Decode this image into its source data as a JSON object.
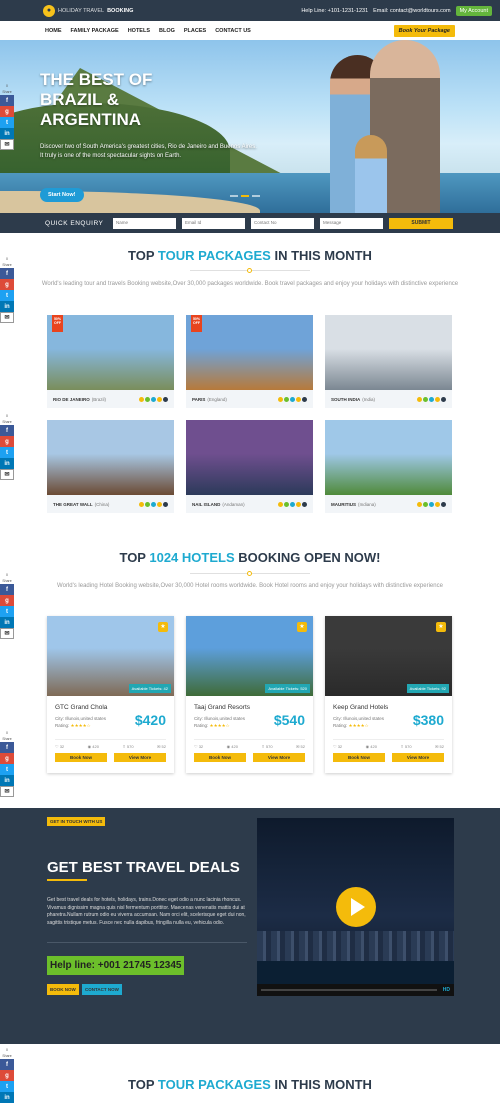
{
  "topbar": {
    "logo_text": "HOLIDAY TRAVEL",
    "logo_bold": "BOOKING",
    "helpline": "Help Line: +101-1231-1231",
    "email": "Email: contact@worldtours.com",
    "my_account": "My Account"
  },
  "nav": {
    "items": [
      "HOME",
      "FAMILY PACKAGE",
      "HOTELS",
      "BLOG",
      "PLACES",
      "CONTACT US"
    ],
    "book_label": "Book Your Package"
  },
  "hero": {
    "title": "THE BEST OF BRAZIL & ARGENTINA",
    "description": "Discover two of South America's greatest cities, Rio de Janeiro and Buenos Aires. It truly is one of the most spectacular sights on Earth.",
    "button": "Start Now!"
  },
  "enquiry": {
    "label": "QUICK ENQUIRY",
    "name_ph": "Name",
    "email_ph": "Email Id",
    "contact_ph": "Contact No",
    "message_ph": "Message",
    "submit": "SUBMIT"
  },
  "share": {
    "heading": "Share"
  },
  "tours_section": {
    "title_a": "TOP ",
    "title_hl": "TOUR PACKAGES",
    "title_b": " IN THIS MONTH",
    "description": "World's leading tour and travels Booking website,Over 30,000 packages worldwide. Book travel packages and enjoy your holidays with distinctive experience"
  },
  "tours": [
    {
      "name": "RIO DE JANEIRO",
      "country": "(Brazil)",
      "offer": "50% OFF",
      "colors": [
        "#86b7dd",
        "#7a8e5b"
      ]
    },
    {
      "name": "PARIS",
      "country": "(England)",
      "offer": "50% OFF",
      "colors": [
        "#6fa3d8",
        "#b77a3a"
      ]
    },
    {
      "name": "SOUTH INDIA",
      "country": "(India)",
      "offer": "",
      "colors": [
        "#d9dfe5",
        "#7b8792"
      ]
    },
    {
      "name": "THE GREAT WALL",
      "country": "(China)",
      "offer": "",
      "colors": [
        "#a8c7e4",
        "#6b4a34"
      ]
    },
    {
      "name": "NAIL ISLAND",
      "country": "(Andaman)",
      "offer": "",
      "colors": [
        "#6f4f8f",
        "#2c3a5a"
      ]
    },
    {
      "name": "MAURITIUS",
      "country": "(Indiana)",
      "offer": "",
      "colors": [
        "#9fc8e8",
        "#4f8a3a"
      ]
    }
  ],
  "hotels_section": {
    "title_a": "TOP ",
    "title_hl": "1024 HOTELS",
    "title_b": " BOOKING OPEN NOW!",
    "description": "World's leading Hotel Booking website,Over 30,000 Hotel rooms worldwide. Book Hotel rooms and enjoy your holidays with distinctive experience"
  },
  "hotels": [
    {
      "name": "GTC Grand Chola",
      "city": "City: Illunois,united states",
      "rating_label": "Rating:",
      "stars": "★★★★☆",
      "price": "$420",
      "available": "Available Tickets: 42",
      "likes": "32",
      "views": "420",
      "shares": "570",
      "comments": "52",
      "book": "Book Now",
      "more": "View More",
      "colors": [
        "#9fc6ea",
        "#7f6a55"
      ]
    },
    {
      "name": "Taaj Grand Resorts",
      "city": "City: Illunois,united states",
      "rating_label": "Rating:",
      "stars": "★★★★☆",
      "price": "$540",
      "available": "Available Tickets: 520",
      "likes": "32",
      "views": "420",
      "shares": "570",
      "comments": "52",
      "book": "Book Now",
      "more": "View More",
      "colors": [
        "#5d9fdc",
        "#3f6b38"
      ]
    },
    {
      "name": "Keep Grand Hotels",
      "city": "City: Illunois,united states",
      "rating_label": "Rating:",
      "stars": "★★★★☆",
      "price": "$380",
      "available": "Available Tickets: 92",
      "likes": "32",
      "views": "420",
      "shares": "570",
      "comments": "52",
      "book": "Book Now",
      "more": "View More",
      "colors": [
        "#3a3a3a",
        "#2a2a2a"
      ]
    }
  ],
  "deals": {
    "tag": "GET IN TOUCH WITH US",
    "title": "GET BEST TRAVEL DEALS",
    "text": "Get best travel deals for hotels, holidays, trains.Donec eget odio a nunc lacinia rhoncus. Vivamus dignissim magna quis nisl fermentum porttitor. Maecenas venenatis mattis dui at pharetra.Nullam rutrum odio eu viverra accumsan. Nam orci elit, scelerisque eget dui non, sagittis tristique metus. Fusce nec nulla dapibus, fringilla nulla eu, vehicula odio.",
    "helpline": "Help line: +001 21745 12345",
    "book_now": "BOOK NOW",
    "contact_now": "CONTACT NOW",
    "video_badge": "HD"
  },
  "tours_section_2": {
    "title_a": "TOP ",
    "title_hl": "TOUR PACKAGES",
    "title_b": " IN THIS MONTH"
  }
}
